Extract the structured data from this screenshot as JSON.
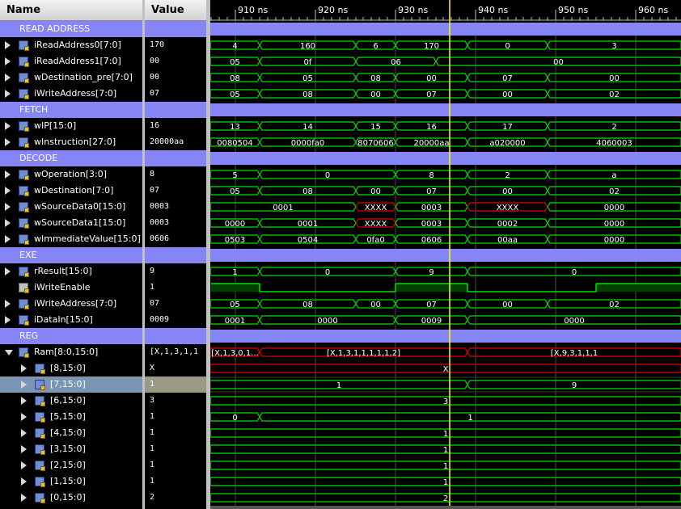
{
  "columns": {
    "name": "Name",
    "value": "Value"
  },
  "time_ruler": {
    "ticks": [
      "910 ns",
      "920 ns",
      "930 ns",
      "940 ns",
      "950 ns",
      "960 ns"
    ]
  },
  "rows": [
    {
      "kind": "group",
      "name": "READ ADDRESS",
      "value": ""
    },
    {
      "kind": "bus",
      "name": "iReadAddress0[7:0]",
      "value": "170",
      "icon": "bus-in-icon",
      "segments": [
        [
          "0",
          "4"
        ],
        [
          "6",
          "160"
        ],
        [
          "18",
          "6"
        ],
        [
          "23",
          "170"
        ],
        [
          "32",
          "0"
        ],
        [
          "42",
          "3"
        ]
      ]
    },
    {
      "kind": "bus",
      "name": "iReadAddress1[7:0]",
      "value": "00",
      "icon": "bus-in-icon",
      "segments": [
        [
          "0",
          "05"
        ],
        [
          "6",
          "0f"
        ],
        [
          "18",
          "06"
        ],
        [
          "28",
          "00"
        ]
      ]
    },
    {
      "kind": "bus",
      "name": "wDestination_pre[7:0]",
      "value": "00",
      "icon": "bus-icon",
      "segments": [
        [
          "0",
          "08"
        ],
        [
          "6",
          "05"
        ],
        [
          "18",
          "08"
        ],
        [
          "23",
          "00"
        ],
        [
          "32",
          "07"
        ],
        [
          "42",
          "00"
        ]
      ]
    },
    {
      "kind": "bus",
      "name": "iWriteAddress[7:0]",
      "value": "07",
      "icon": "bus-in-icon",
      "segments": [
        [
          "0",
          "05"
        ],
        [
          "6",
          "08"
        ],
        [
          "18",
          "00"
        ],
        [
          "23",
          "07"
        ],
        [
          "32",
          "00"
        ],
        [
          "42",
          "02"
        ]
      ]
    },
    {
      "kind": "group",
      "name": "FETCH",
      "value": ""
    },
    {
      "kind": "bus",
      "name": "wIP[15:0]",
      "value": "16",
      "icon": "bus-icon",
      "segments": [
        [
          "0",
          "13"
        ],
        [
          "6",
          "14"
        ],
        [
          "18",
          "15"
        ],
        [
          "23",
          "16"
        ],
        [
          "32",
          "17"
        ],
        [
          "42",
          "2"
        ]
      ]
    },
    {
      "kind": "bus",
      "name": "wInstruction[27:0]",
      "value": "20000aa",
      "icon": "bus-icon",
      "segments": [
        [
          "0",
          "0080504"
        ],
        [
          "6",
          "0000fa0"
        ],
        [
          "18",
          "8070606"
        ],
        [
          "23",
          "20000aa"
        ],
        [
          "32",
          "a020000"
        ],
        [
          "42",
          "4060003"
        ]
      ]
    },
    {
      "kind": "group",
      "name": "DECODE",
      "value": ""
    },
    {
      "kind": "bus",
      "name": "wOperation[3:0]",
      "value": "8",
      "icon": "bus-icon",
      "segments": [
        [
          "0",
          "5"
        ],
        [
          "6",
          "0"
        ],
        [
          "23",
          "8"
        ],
        [
          "32",
          "2"
        ],
        [
          "42",
          "a"
        ]
      ]
    },
    {
      "kind": "bus",
      "name": "wDestination[7:0]",
      "value": "07",
      "icon": "bus-icon",
      "segments": [
        [
          "0",
          "05"
        ],
        [
          "6",
          "08"
        ],
        [
          "18",
          "00"
        ],
        [
          "23",
          "07"
        ],
        [
          "32",
          "00"
        ],
        [
          "42",
          "02"
        ]
      ]
    },
    {
      "kind": "bus",
      "name": "wSourceData0[15:0]",
      "value": "0003",
      "icon": "bus-icon",
      "segments": [
        [
          "0",
          "0001"
        ],
        [
          "18",
          "XXXX",
          "x"
        ],
        [
          "23",
          "0003"
        ],
        [
          "32",
          "XXXX",
          "x"
        ],
        [
          "42",
          "0000"
        ]
      ]
    },
    {
      "kind": "bus",
      "name": "wSourceData1[15:0]",
      "value": "0003",
      "icon": "bus-icon",
      "segments": [
        [
          "0",
          "0000"
        ],
        [
          "6",
          "0001"
        ],
        [
          "18",
          "XXXX",
          "x"
        ],
        [
          "23",
          "0003"
        ],
        [
          "32",
          "0002"
        ],
        [
          "42",
          "0000"
        ]
      ]
    },
    {
      "kind": "bus",
      "name": "wImmediateValue[15:0]",
      "value": "0606",
      "icon": "bus-icon",
      "segments": [
        [
          "0",
          "0503"
        ],
        [
          "6",
          "0504"
        ],
        [
          "18",
          "0fa0"
        ],
        [
          "23",
          "0606"
        ],
        [
          "32",
          "00aa"
        ],
        [
          "42",
          "0000"
        ]
      ]
    },
    {
      "kind": "group",
      "name": "EXE",
      "value": ""
    },
    {
      "kind": "bus",
      "name": "rResult[15:0]",
      "value": "9",
      "icon": "bus-icon",
      "segments": [
        [
          "0",
          "1"
        ],
        [
          "6",
          "0"
        ],
        [
          "23",
          "9"
        ],
        [
          "32",
          "0"
        ]
      ]
    },
    {
      "kind": "bit",
      "name": "iWriteEnable",
      "value": "1",
      "icon": "bit-in-icon",
      "levels": [
        [
          "0",
          "1"
        ],
        [
          "6",
          "0"
        ],
        [
          "23",
          "1"
        ],
        [
          "32",
          "0"
        ],
        [
          "48",
          "1"
        ]
      ]
    },
    {
      "kind": "bus",
      "name": "iWriteAddress[7:0]",
      "value": "07",
      "icon": "bus-in-icon",
      "segments": [
        [
          "0",
          "05"
        ],
        [
          "6",
          "08"
        ],
        [
          "18",
          "00"
        ],
        [
          "23",
          "07"
        ],
        [
          "32",
          "00"
        ],
        [
          "42",
          "02"
        ]
      ]
    },
    {
      "kind": "bus",
      "name": "iDataIn[15:0]",
      "value": "0009",
      "icon": "bus-in-icon",
      "segments": [
        [
          "0",
          "0001"
        ],
        [
          "6",
          "0000"
        ],
        [
          "23",
          "0009"
        ],
        [
          "32",
          "0000"
        ]
      ]
    },
    {
      "kind": "group",
      "name": "REG",
      "value": ""
    },
    {
      "kind": "bus",
      "name": "Ram[8:0,15:0]",
      "value": "[X,1,3,1,1",
      "icon": "bus-icon",
      "expanded": true,
      "segments": [
        [
          "0",
          "[X,1,3,0,1...",
          "x"
        ],
        [
          "6",
          "[X,1,3,1,1,1,1,1,2]",
          "x"
        ],
        [
          "32",
          "[X,9,3,1,1,1",
          "x"
        ]
      ]
    },
    {
      "kind": "bus",
      "name": "[8,15:0]",
      "value": "X",
      "icon": "bus-icon",
      "child": true,
      "segments": [
        [
          "0",
          "X",
          "x"
        ]
      ]
    },
    {
      "kind": "bus",
      "name": "[7,15:0]",
      "value": "1",
      "icon": "bus-icon",
      "child": true,
      "selected": true,
      "segments": [
        [
          "0",
          "1"
        ],
        [
          "32",
          "9"
        ]
      ]
    },
    {
      "kind": "bus",
      "name": "[6,15:0]",
      "value": "3",
      "icon": "bus-icon",
      "child": true,
      "segments": [
        [
          "0",
          "3"
        ]
      ]
    },
    {
      "kind": "bus",
      "name": "[5,15:0]",
      "value": "1",
      "icon": "bus-icon",
      "child": true,
      "segments": [
        [
          "0",
          "0"
        ],
        [
          "6",
          "1"
        ]
      ]
    },
    {
      "kind": "bus",
      "name": "[4,15:0]",
      "value": "1",
      "icon": "bus-icon",
      "child": true,
      "segments": [
        [
          "0",
          "1"
        ]
      ]
    },
    {
      "kind": "bus",
      "name": "[3,15:0]",
      "value": "1",
      "icon": "bus-icon",
      "child": true,
      "segments": [
        [
          "0",
          "1"
        ]
      ]
    },
    {
      "kind": "bus",
      "name": "[2,15:0]",
      "value": "1",
      "icon": "bus-icon",
      "child": true,
      "segments": [
        [
          "0",
          "1"
        ]
      ]
    },
    {
      "kind": "bus",
      "name": "[1,15:0]",
      "value": "1",
      "icon": "bus-icon",
      "child": true,
      "segments": [
        [
          "0",
          "1"
        ]
      ]
    },
    {
      "kind": "bus",
      "name": "[0,15:0]",
      "value": "2",
      "icon": "bus-icon",
      "child": true,
      "segments": [
        [
          "0",
          "2"
        ]
      ]
    }
  ],
  "colors": {
    "group_bg": "#8585f5",
    "wave": "#00e000",
    "undefined": "#e00000",
    "cursor": "#ffff00",
    "grid": "#4a4a4a"
  }
}
